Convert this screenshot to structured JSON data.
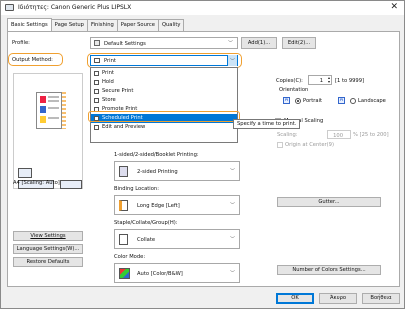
{
  "window": {
    "title": "Ιδιότητες: Canon Generic Plus LIPSLX",
    "close_glyph": "✕"
  },
  "tabs": [
    "Basic Settings",
    "Page Setup",
    "Finishing",
    "Paper Source",
    "Quality"
  ],
  "profile": {
    "label": "Profile:",
    "value": "Default Settings",
    "add_label": "Add(1)...",
    "edit_label": "Edit(2)..."
  },
  "output_method": {
    "label": "Output Method:",
    "value": "Print"
  },
  "output_list": [
    "Print",
    "Hold",
    "Secure Print",
    "Store",
    "Promote Print",
    "Scheduled Print",
    "Edit and Preview"
  ],
  "tooltip": "Specify a time to print.",
  "copies": {
    "label": "Copies(C):",
    "value": "1",
    "range": "[1 to 9999]"
  },
  "orientation": {
    "label": "Orientation",
    "portrait": "Portrait",
    "landscape": "Landscape"
  },
  "manual_scaling": {
    "label": "Manual Scaling",
    "scaling_label": "Scaling:",
    "value": "100",
    "range": "% [25 to 200]",
    "origin_label": "Origin at Center(9)"
  },
  "booklet": {
    "label": "1-sided/2-sided/Booklet Printing:",
    "value": "2-sided Printing"
  },
  "binding": {
    "label": "Binding Location:",
    "value": "Long Edge [Left]",
    "gutter_label": "Gutter..."
  },
  "staple": {
    "label": "Staple/Collate/Group(H):",
    "value": "Collate"
  },
  "color_mode": {
    "label": "Color Mode:",
    "value": "Auto [Color/B&W]",
    "colors_btn": "Number of Colors Settings..."
  },
  "preview": {
    "caption": "A4 [Scaling: Auto]"
  },
  "left_buttons": {
    "view": "View Settings",
    "language": "Language Settings(W)...",
    "restore": "Restore Defaults"
  },
  "footer": {
    "ok": "OK",
    "cancel": "Άκυρο",
    "help": "Βοήθεια"
  }
}
